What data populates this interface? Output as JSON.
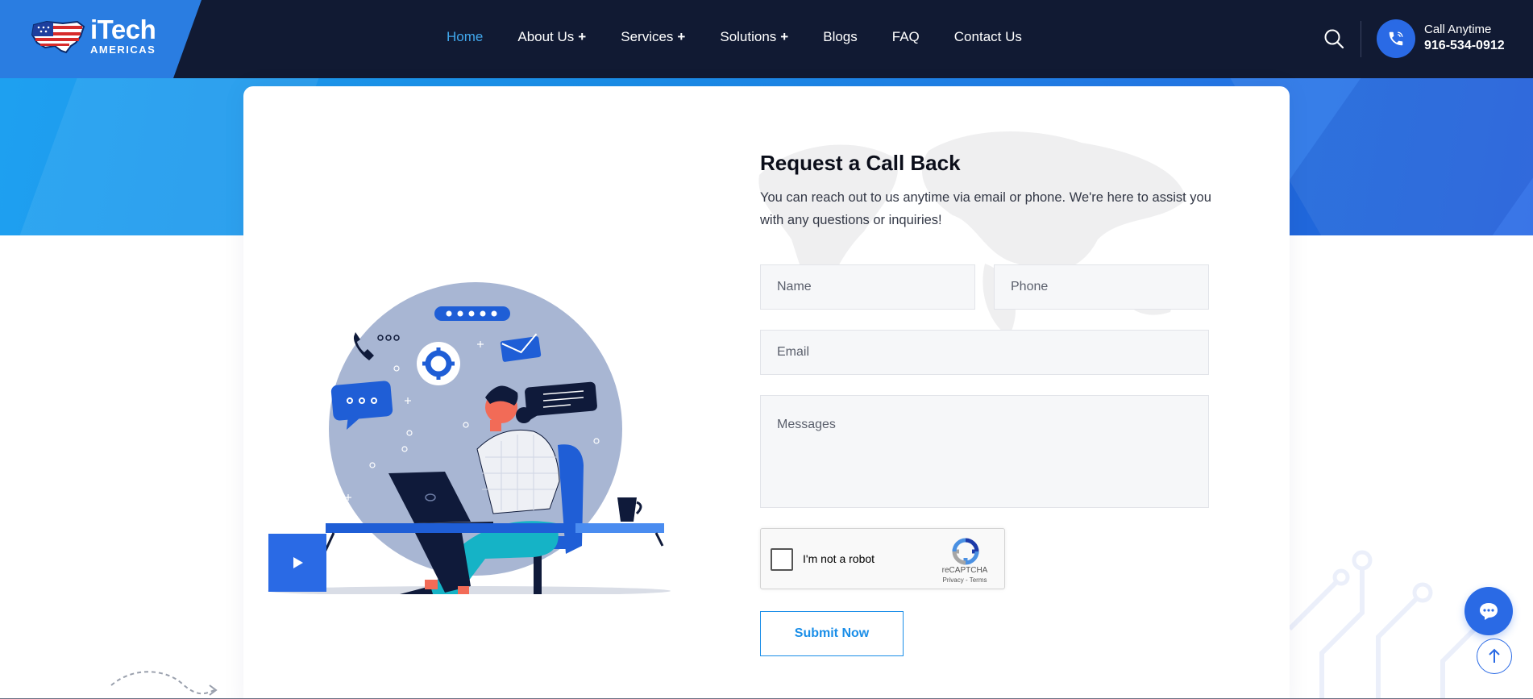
{
  "header": {
    "logo": {
      "main": "iTech",
      "sub": "AMERICAS"
    },
    "nav": [
      {
        "label": "Home",
        "active": true,
        "has_submenu": false
      },
      {
        "label": "About Us",
        "active": false,
        "has_submenu": true
      },
      {
        "label": "Services",
        "active": false,
        "has_submenu": true
      },
      {
        "label": "Solutions",
        "active": false,
        "has_submenu": true
      },
      {
        "label": "Blogs",
        "active": false,
        "has_submenu": false
      },
      {
        "label": "FAQ",
        "active": false,
        "has_submenu": false
      },
      {
        "label": "Contact Us",
        "active": false,
        "has_submenu": false
      }
    ],
    "submenu_symbol": "+",
    "call_label": "Call Anytime",
    "call_number": "916-534-0912"
  },
  "form": {
    "title": "Request a Call Back",
    "description": "You can reach out to us anytime via email or phone. We're here to assist you with any questions or inquiries!",
    "name_placeholder": "Name",
    "phone_placeholder": "Phone",
    "email_placeholder": "Email",
    "message_placeholder": "Messages",
    "captcha_label": "I'm not a robot",
    "captcha_brand": "reCAPTCHA",
    "captcha_links": "Privacy - Terms",
    "submit_label": "Submit Now"
  },
  "icons": {
    "search": "search-icon",
    "phone": "phone-icon",
    "play": "play-icon",
    "chat": "chat-icon",
    "arrow_up": "arrow-up-icon"
  },
  "colors": {
    "header_bg": "#111a33",
    "accent_blue": "#2a6ae5",
    "light_blue": "#1a8ee8",
    "active_nav": "#41a7ec"
  }
}
